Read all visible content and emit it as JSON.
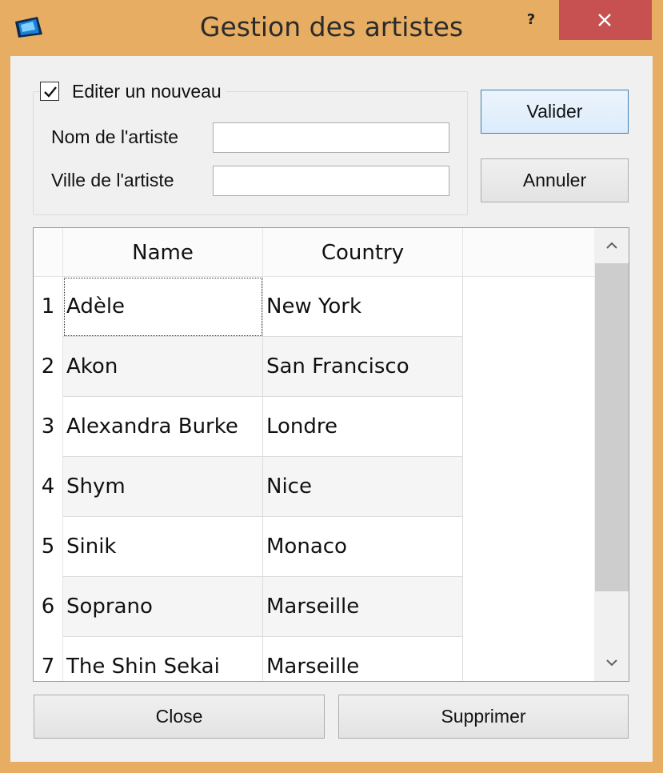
{
  "window": {
    "title": "Gestion des artistes",
    "help_label": "?"
  },
  "form": {
    "new_checkbox_label": "Editer un nouveau",
    "new_checked": true,
    "name_label": "Nom de l'artiste",
    "name_value": "",
    "city_label": "Ville de l'artiste",
    "city_value": ""
  },
  "buttons": {
    "validate": "Valider",
    "cancel": "Annuler",
    "close": "Close",
    "delete": "Supprimer"
  },
  "table": {
    "columns": [
      "Name",
      "Country"
    ],
    "rows": [
      {
        "num": "1",
        "name": "Adèle",
        "country": "New York"
      },
      {
        "num": "2",
        "name": "Akon",
        "country": "San Francisco"
      },
      {
        "num": "3",
        "name": "Alexandra Burke",
        "country": "Londre"
      },
      {
        "num": "4",
        "name": "Shym",
        "country": "Nice"
      },
      {
        "num": "5",
        "name": "Sinik",
        "country": "Monaco"
      },
      {
        "num": "6",
        "name": "Soprano",
        "country": "Marseille"
      },
      {
        "num": "7",
        "name": "The Shin Sekai",
        "country": "Marseille"
      }
    ]
  },
  "colors": {
    "frame": "#e6ad63",
    "close_button": "#c75050",
    "client": "#f0f0f0"
  }
}
